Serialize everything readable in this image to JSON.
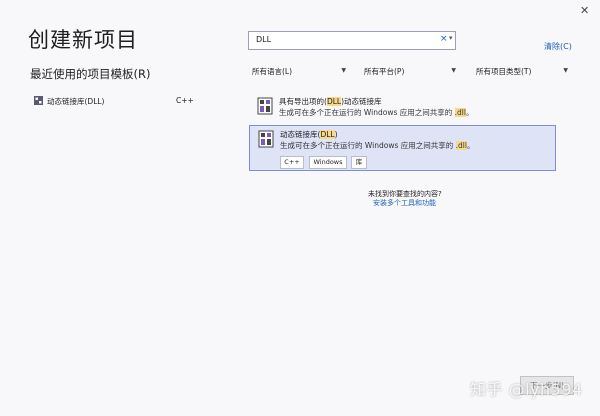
{
  "window": {
    "close_label": "✕"
  },
  "header": {
    "title": "创建新项目"
  },
  "search": {
    "value": "DLL",
    "clear_icon": "×",
    "dropdown_icon": "▾",
    "clear_all_label": "清除(C)"
  },
  "recent": {
    "title": "最近使用的项目模板(R)",
    "items": [
      {
        "label": "动态链接库(DLL)",
        "lang": "C++"
      }
    ]
  },
  "filters": [
    {
      "label": "所有语言(L)"
    },
    {
      "label": "所有平台(P)"
    },
    {
      "label": "所有项目类型(T)"
    }
  ],
  "results": [
    {
      "title_pre": "具有导出项的(",
      "title_hl": "DLL",
      "title_post": ")动态链接库",
      "desc_pre": "生成可在多个正在运行的 Windows 应用之间共享的 ",
      "desc_hl": ".dll",
      "desc_post": "。",
      "tags": []
    },
    {
      "title_pre": "动态链接库(",
      "title_hl": "DLL",
      "title_post": ")",
      "desc_pre": "生成可在多个正在运行的 Windows 应用之间共享的 ",
      "desc_hl": ".dll",
      "desc_post": "。",
      "tags": [
        "C++",
        "Windows",
        "库"
      ]
    }
  ],
  "help": {
    "question": "未找到你要查找的内容?",
    "link": "安装多个工具和功能"
  },
  "footer": {
    "next_label": "下一步(N)",
    "watermark": "知乎 @lyh594"
  },
  "colors": {
    "accent": "#1a5fb4",
    "selected_bg": "#dee3f6",
    "selected_border": "#7f8ed6",
    "highlight": "#f7d98c"
  }
}
